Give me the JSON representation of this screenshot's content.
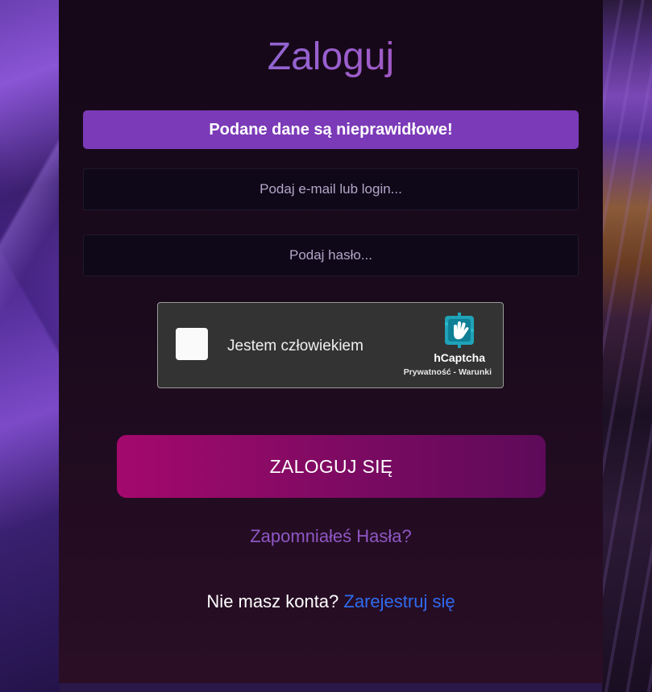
{
  "page": {
    "title": "Zaloguj"
  },
  "error": {
    "message": "Podane dane są nieprawidłowe!"
  },
  "form": {
    "email_placeholder": "Podaj e-mail lub login...",
    "password_placeholder": "Podaj hasło...",
    "submit_label": "ZALOGUJ SIĘ"
  },
  "captcha": {
    "checkbox_label": "Jestem człowiekiem",
    "brand": "hCaptcha",
    "links": "Prywatność - Warunki",
    "icon": "hcaptcha-hand-icon"
  },
  "links": {
    "forgot_password": "Zapomniałeś Hasła?",
    "no_account": "Nie masz konta?",
    "register": "Zarejestruj się"
  },
  "colors": {
    "error_bg": "#7b3ab8",
    "button_gradient_start": "#a4096c",
    "button_gradient_end": "#5e0a5a",
    "forgot_link": "#8e57c4",
    "register_link": "#2f6bf0"
  }
}
